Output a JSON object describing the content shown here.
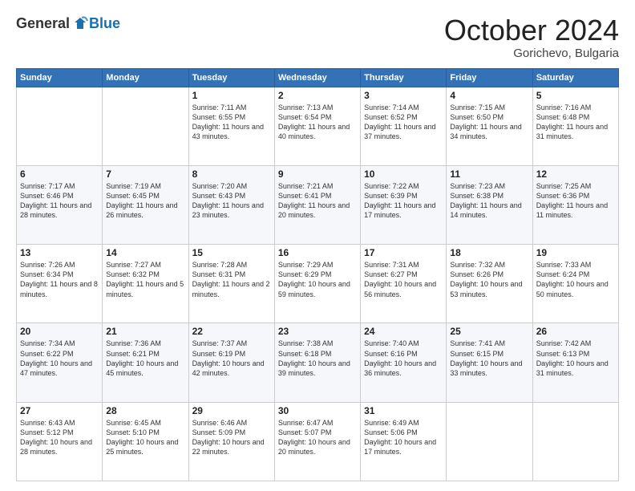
{
  "logo": {
    "general": "General",
    "blue": "Blue"
  },
  "header": {
    "month": "October 2024",
    "location": "Gorichevo, Bulgaria"
  },
  "weekdays": [
    "Sunday",
    "Monday",
    "Tuesday",
    "Wednesday",
    "Thursday",
    "Friday",
    "Saturday"
  ],
  "weeks": [
    [
      {
        "day": "",
        "sunrise": "",
        "sunset": "",
        "daylight": ""
      },
      {
        "day": "",
        "sunrise": "",
        "sunset": "",
        "daylight": ""
      },
      {
        "day": "1",
        "sunrise": "Sunrise: 7:11 AM",
        "sunset": "Sunset: 6:55 PM",
        "daylight": "Daylight: 11 hours and 43 minutes."
      },
      {
        "day": "2",
        "sunrise": "Sunrise: 7:13 AM",
        "sunset": "Sunset: 6:54 PM",
        "daylight": "Daylight: 11 hours and 40 minutes."
      },
      {
        "day": "3",
        "sunrise": "Sunrise: 7:14 AM",
        "sunset": "Sunset: 6:52 PM",
        "daylight": "Daylight: 11 hours and 37 minutes."
      },
      {
        "day": "4",
        "sunrise": "Sunrise: 7:15 AM",
        "sunset": "Sunset: 6:50 PM",
        "daylight": "Daylight: 11 hours and 34 minutes."
      },
      {
        "day": "5",
        "sunrise": "Sunrise: 7:16 AM",
        "sunset": "Sunset: 6:48 PM",
        "daylight": "Daylight: 11 hours and 31 minutes."
      }
    ],
    [
      {
        "day": "6",
        "sunrise": "Sunrise: 7:17 AM",
        "sunset": "Sunset: 6:46 PM",
        "daylight": "Daylight: 11 hours and 28 minutes."
      },
      {
        "day": "7",
        "sunrise": "Sunrise: 7:19 AM",
        "sunset": "Sunset: 6:45 PM",
        "daylight": "Daylight: 11 hours and 26 minutes."
      },
      {
        "day": "8",
        "sunrise": "Sunrise: 7:20 AM",
        "sunset": "Sunset: 6:43 PM",
        "daylight": "Daylight: 11 hours and 23 minutes."
      },
      {
        "day": "9",
        "sunrise": "Sunrise: 7:21 AM",
        "sunset": "Sunset: 6:41 PM",
        "daylight": "Daylight: 11 hours and 20 minutes."
      },
      {
        "day": "10",
        "sunrise": "Sunrise: 7:22 AM",
        "sunset": "Sunset: 6:39 PM",
        "daylight": "Daylight: 11 hours and 17 minutes."
      },
      {
        "day": "11",
        "sunrise": "Sunrise: 7:23 AM",
        "sunset": "Sunset: 6:38 PM",
        "daylight": "Daylight: 11 hours and 14 minutes."
      },
      {
        "day": "12",
        "sunrise": "Sunrise: 7:25 AM",
        "sunset": "Sunset: 6:36 PM",
        "daylight": "Daylight: 11 hours and 11 minutes."
      }
    ],
    [
      {
        "day": "13",
        "sunrise": "Sunrise: 7:26 AM",
        "sunset": "Sunset: 6:34 PM",
        "daylight": "Daylight: 11 hours and 8 minutes."
      },
      {
        "day": "14",
        "sunrise": "Sunrise: 7:27 AM",
        "sunset": "Sunset: 6:32 PM",
        "daylight": "Daylight: 11 hours and 5 minutes."
      },
      {
        "day": "15",
        "sunrise": "Sunrise: 7:28 AM",
        "sunset": "Sunset: 6:31 PM",
        "daylight": "Daylight: 11 hours and 2 minutes."
      },
      {
        "day": "16",
        "sunrise": "Sunrise: 7:29 AM",
        "sunset": "Sunset: 6:29 PM",
        "daylight": "Daylight: 10 hours and 59 minutes."
      },
      {
        "day": "17",
        "sunrise": "Sunrise: 7:31 AM",
        "sunset": "Sunset: 6:27 PM",
        "daylight": "Daylight: 10 hours and 56 minutes."
      },
      {
        "day": "18",
        "sunrise": "Sunrise: 7:32 AM",
        "sunset": "Sunset: 6:26 PM",
        "daylight": "Daylight: 10 hours and 53 minutes."
      },
      {
        "day": "19",
        "sunrise": "Sunrise: 7:33 AM",
        "sunset": "Sunset: 6:24 PM",
        "daylight": "Daylight: 10 hours and 50 minutes."
      }
    ],
    [
      {
        "day": "20",
        "sunrise": "Sunrise: 7:34 AM",
        "sunset": "Sunset: 6:22 PM",
        "daylight": "Daylight: 10 hours and 47 minutes."
      },
      {
        "day": "21",
        "sunrise": "Sunrise: 7:36 AM",
        "sunset": "Sunset: 6:21 PM",
        "daylight": "Daylight: 10 hours and 45 minutes."
      },
      {
        "day": "22",
        "sunrise": "Sunrise: 7:37 AM",
        "sunset": "Sunset: 6:19 PM",
        "daylight": "Daylight: 10 hours and 42 minutes."
      },
      {
        "day": "23",
        "sunrise": "Sunrise: 7:38 AM",
        "sunset": "Sunset: 6:18 PM",
        "daylight": "Daylight: 10 hours and 39 minutes."
      },
      {
        "day": "24",
        "sunrise": "Sunrise: 7:40 AM",
        "sunset": "Sunset: 6:16 PM",
        "daylight": "Daylight: 10 hours and 36 minutes."
      },
      {
        "day": "25",
        "sunrise": "Sunrise: 7:41 AM",
        "sunset": "Sunset: 6:15 PM",
        "daylight": "Daylight: 10 hours and 33 minutes."
      },
      {
        "day": "26",
        "sunrise": "Sunrise: 7:42 AM",
        "sunset": "Sunset: 6:13 PM",
        "daylight": "Daylight: 10 hours and 31 minutes."
      }
    ],
    [
      {
        "day": "27",
        "sunrise": "Sunrise: 6:43 AM",
        "sunset": "Sunset: 5:12 PM",
        "daylight": "Daylight: 10 hours and 28 minutes."
      },
      {
        "day": "28",
        "sunrise": "Sunrise: 6:45 AM",
        "sunset": "Sunset: 5:10 PM",
        "daylight": "Daylight: 10 hours and 25 minutes."
      },
      {
        "day": "29",
        "sunrise": "Sunrise: 6:46 AM",
        "sunset": "Sunset: 5:09 PM",
        "daylight": "Daylight: 10 hours and 22 minutes."
      },
      {
        "day": "30",
        "sunrise": "Sunrise: 6:47 AM",
        "sunset": "Sunset: 5:07 PM",
        "daylight": "Daylight: 10 hours and 20 minutes."
      },
      {
        "day": "31",
        "sunrise": "Sunrise: 6:49 AM",
        "sunset": "Sunset: 5:06 PM",
        "daylight": "Daylight: 10 hours and 17 minutes."
      },
      {
        "day": "",
        "sunrise": "",
        "sunset": "",
        "daylight": ""
      },
      {
        "day": "",
        "sunrise": "",
        "sunset": "",
        "daylight": ""
      }
    ]
  ]
}
